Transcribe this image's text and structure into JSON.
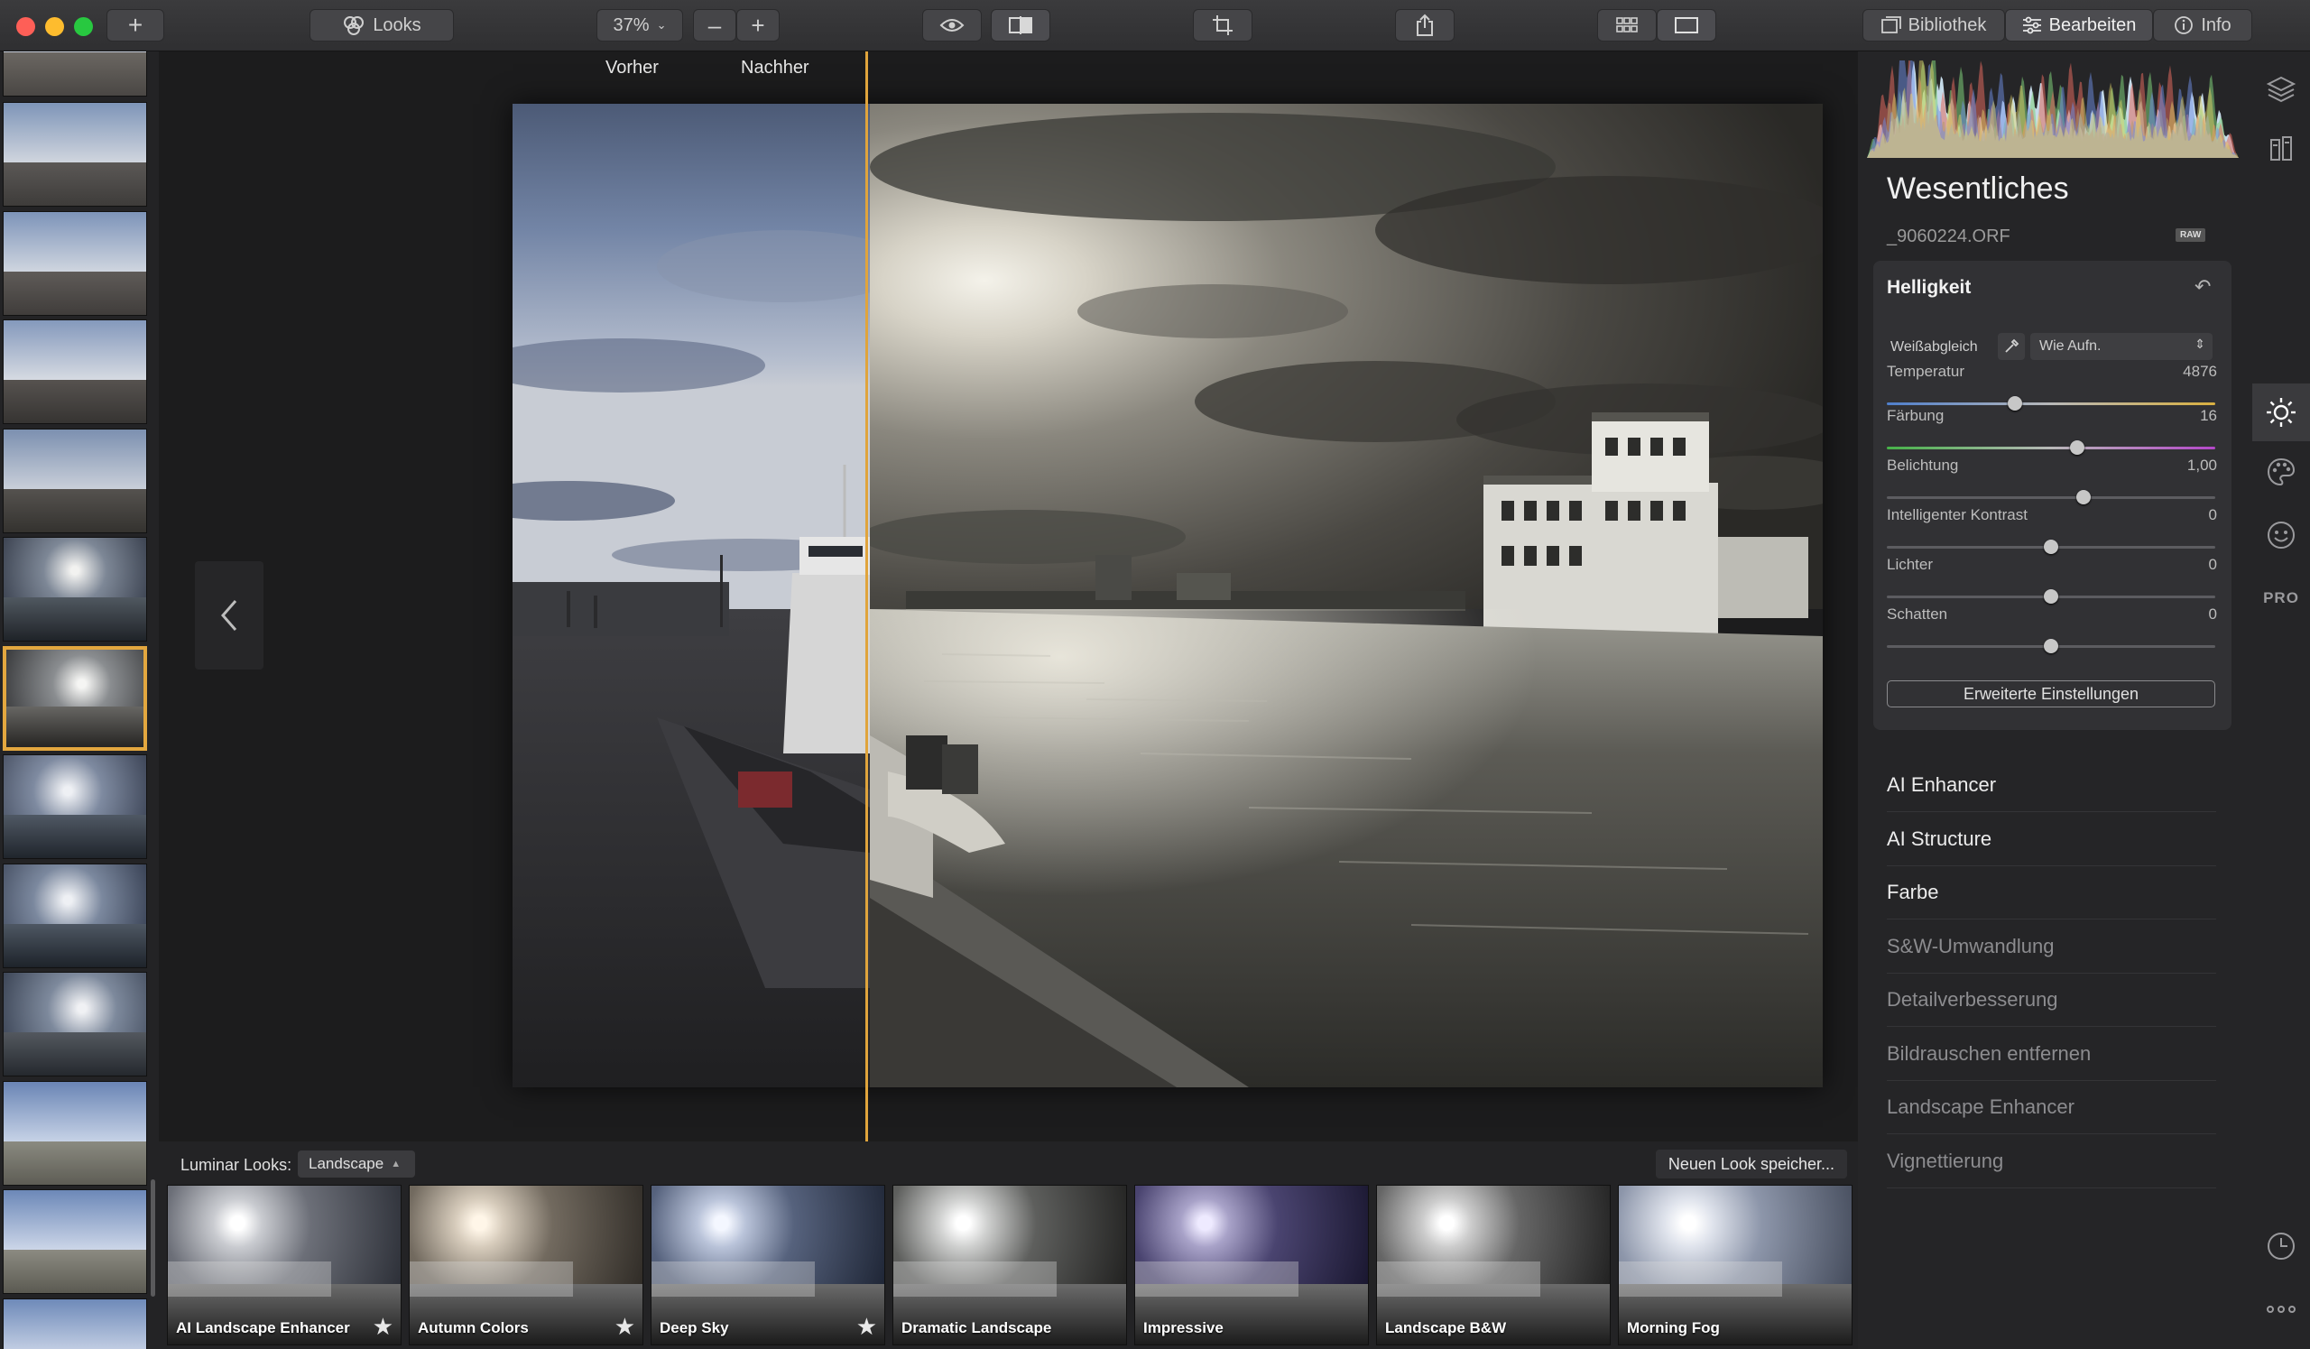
{
  "toolbar": {
    "looks_label": "Looks",
    "zoom_value": "37%",
    "bibliothek": "Bibliothek",
    "bearbeiten": "Bearbeiten",
    "info": "Info"
  },
  "compare": {
    "before_label": "Vorher",
    "after_label": "Nachher"
  },
  "looks_bar": {
    "label": "Luminar Looks:",
    "category": "Landscape",
    "save_button": "Neuen Look speicher...",
    "items": [
      {
        "name": "AI Landscape Enhancer",
        "starred": true
      },
      {
        "name": "Autumn Colors",
        "starred": true
      },
      {
        "name": "Deep Sky",
        "starred": true
      },
      {
        "name": "Dramatic Landscape",
        "starred": false
      },
      {
        "name": "Impressive",
        "starred": false
      },
      {
        "name": "Landscape B&W",
        "starred": false
      },
      {
        "name": "Morning Fog",
        "starred": false
      }
    ]
  },
  "panel": {
    "title": "Wesentliches",
    "filename": "_9060224.ORF",
    "raw_badge": "RAW",
    "section": {
      "title": "Helligkeit",
      "white_balance_label": "Weißabgleich",
      "white_balance_value": "Wie Aufn.",
      "sliders": [
        {
          "label": "Temperatur",
          "value": "4876",
          "level": 0.39
        },
        {
          "label": "Färbung",
          "value": "16",
          "level": 0.58
        },
        {
          "label": "Belichtung",
          "value": "1,00",
          "level": 0.6
        },
        {
          "label": "Intelligenter Kontrast",
          "value": "0",
          "level": 0.5
        },
        {
          "label": "Lichter",
          "value": "0",
          "level": 0.5
        },
        {
          "label": "Schatten",
          "value": "0",
          "level": 0.5
        }
      ],
      "advanced_button": "Erweiterte Einstellungen"
    },
    "tools": [
      {
        "label": "AI Enhancer",
        "enabled": true
      },
      {
        "label": "AI Structure",
        "enabled": true
      },
      {
        "label": "Farbe",
        "enabled": true
      },
      {
        "label": "S&W-Umwandlung",
        "enabled": false
      },
      {
        "label": "Detailverbesserung",
        "enabled": false
      },
      {
        "label": "Bildrauschen entfernen",
        "enabled": false
      },
      {
        "label": "Landscape Enhancer",
        "enabled": false
      },
      {
        "label": "Vignettierung",
        "enabled": false
      }
    ]
  },
  "side_icons": {
    "pro_label": "PRO"
  },
  "colors": {
    "accent": "#e0a43c",
    "bg_dark": "#1c1c1d",
    "panel": "#252527"
  }
}
